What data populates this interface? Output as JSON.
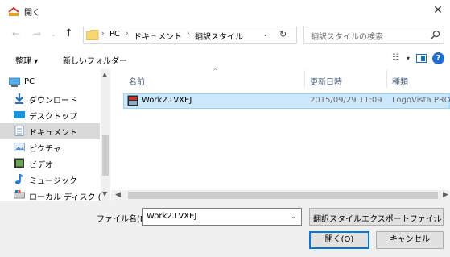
{
  "window": {
    "title": "開く",
    "close_glyph": "✕"
  },
  "nav": {
    "back_glyph": "←",
    "forward_glyph": "→",
    "recent_glyph": "⌄",
    "up_glyph": "↑"
  },
  "address": {
    "crumbs": [
      "PC",
      "ドキュメント",
      "翻訳スタイル"
    ],
    "separator": "›",
    "dropdown_glyph": "⌄",
    "refresh_glyph": "↻"
  },
  "search": {
    "placeholder": "翻訳スタイルの検索"
  },
  "toolbar": {
    "organize_label": "整理 ▾",
    "new_folder_label": "新しいフォルダー",
    "view_glyph": "☷",
    "view_drop_glyph": "▾",
    "help_glyph": "?"
  },
  "sidebar": {
    "items": [
      {
        "label": "PC",
        "icon": "pc-icon"
      },
      {
        "label": "ダウンロード",
        "icon": "download-icon"
      },
      {
        "label": "デスクトップ",
        "icon": "desktop-icon"
      },
      {
        "label": "ドキュメント",
        "icon": "documents-icon",
        "selected": true
      },
      {
        "label": "ピクチャ",
        "icon": "pictures-icon"
      },
      {
        "label": "ビデオ",
        "icon": "videos-icon"
      },
      {
        "label": "ミュージック",
        "icon": "music-icon"
      },
      {
        "label": "ローカル ディスク (C",
        "icon": "disk-icon"
      }
    ]
  },
  "columns": {
    "name": "名前",
    "date": "更新日時",
    "type": "種類"
  },
  "files": [
    {
      "name": "Work2.LVXEJ",
      "date": "2015/09/29 11:09",
      "type": "LogoVista PRO"
    }
  ],
  "footer": {
    "filename_label": "ファイル名(N):",
    "filename_value": "Work2.LVXEJ",
    "filetype_value": "翻訳スタイルエクスポートファイル (*.L",
    "open_label": "開く(O)",
    "cancel_label": "キャンセル"
  },
  "colors": {
    "accent": "#0078d7",
    "selection": "#cce8ff",
    "folder": "#f8d775"
  }
}
